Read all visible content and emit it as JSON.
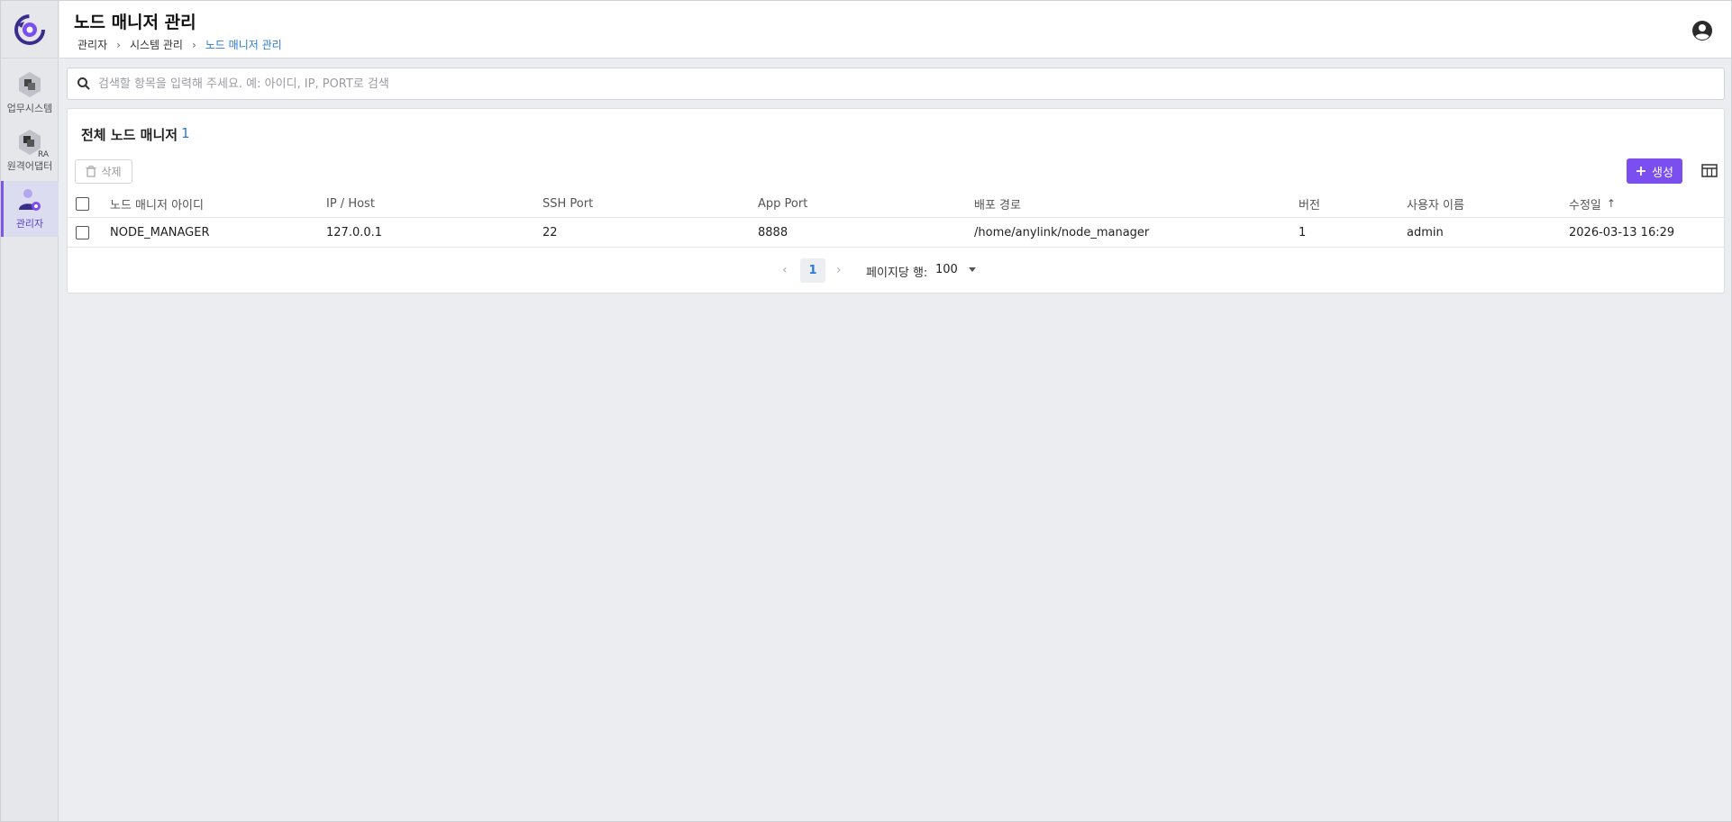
{
  "sidebar": {
    "items": [
      {
        "label": "업무시스템",
        "icon": "business-system-icon",
        "active": false
      },
      {
        "label": "원격어댑터",
        "icon": "remote-adapter-icon",
        "badge": "RA",
        "active": false
      },
      {
        "label": "관리자",
        "icon": "admin-user-icon",
        "active": true
      }
    ]
  },
  "header": {
    "title": "노드 매니저 관리",
    "breadcrumb": [
      "관리자",
      "시스템 관리",
      "노드 매니저 관리"
    ]
  },
  "search": {
    "placeholder": "검색할 항목을 입력해 주세요. 예: 아이디, IP, PORT로 검색"
  },
  "card": {
    "title": "전체 노드 매니저",
    "count": "1",
    "delete_label": "삭제",
    "create_label": "생성"
  },
  "table": {
    "columns": [
      "노드 매니저 아이디",
      "IP / Host",
      "SSH Port",
      "App Port",
      "배포 경로",
      "버전",
      "사용자 이름",
      "수정일"
    ],
    "sort_indicator": "↑",
    "rows": [
      [
        "NODE_MANAGER",
        "127.0.0.1",
        "22",
        "8888",
        "/home/anylink/node_manager",
        "1",
        "admin",
        "2026-03-13 16:29"
      ]
    ]
  },
  "pagination": {
    "current_page": "1",
    "rows_per_page_label": "페이지당 행:",
    "rows_per_page": "100"
  },
  "colors": {
    "accent": "#7b4ef0",
    "link": "#2b7ad9"
  }
}
